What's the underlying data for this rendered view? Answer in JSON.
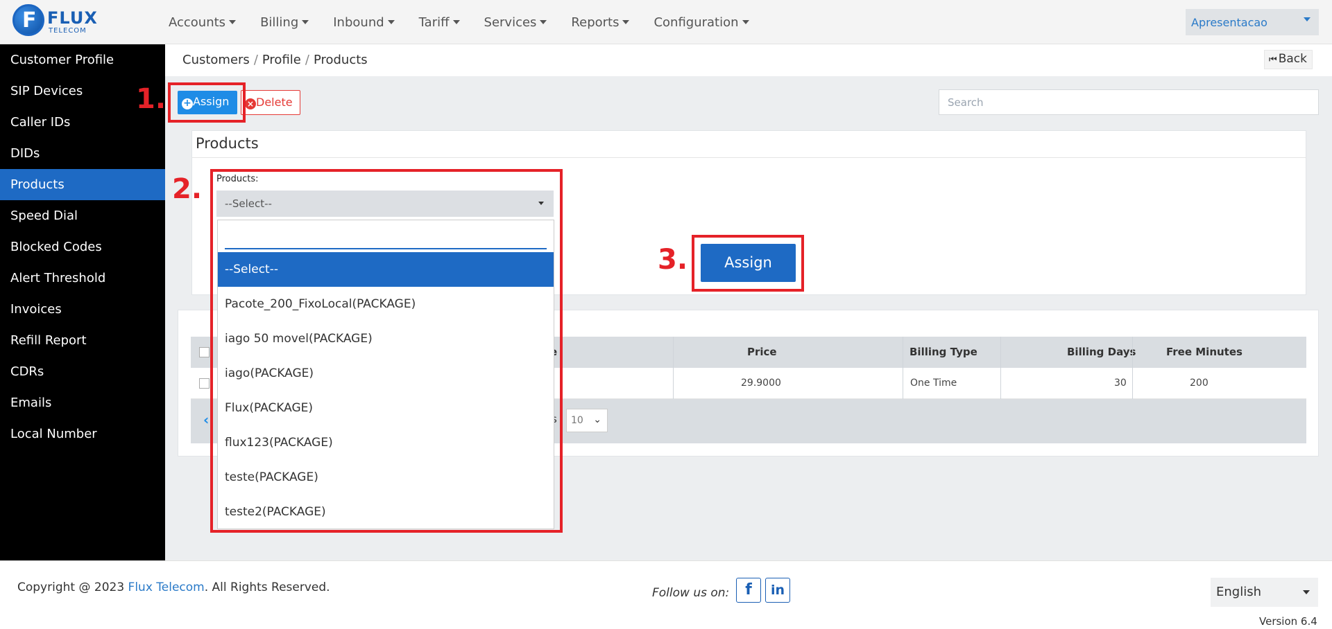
{
  "brand": {
    "name": "FLUX",
    "sub": "TELECOM"
  },
  "nav": {
    "items": [
      "Accounts",
      "Billing",
      "Inbound",
      "Tariff",
      "Services",
      "Reports",
      "Configuration"
    ],
    "account": "Apresentacao"
  },
  "sidebar": {
    "items": [
      "Customer Profile",
      "SIP Devices",
      "Caller IDs",
      "DIDs",
      "Products",
      "Speed Dial",
      "Blocked Codes",
      "Alert Threshold",
      "Invoices",
      "Refill Report",
      "CDRs",
      "Emails",
      "Local Number"
    ],
    "active": "Products"
  },
  "breadcrumb": {
    "items": [
      "Customers",
      "Profile",
      "Products"
    ]
  },
  "back_label": "Back",
  "toolbar": {
    "assign_label": "Assign",
    "delete_label": "Delete",
    "search_placeholder": "Search"
  },
  "products_panel": {
    "title": "Products",
    "field_label": "Products:",
    "selected": "--Select--",
    "assign_button": "Assign"
  },
  "dropdown": {
    "options": [
      "--Select--",
      "Pacote_200_FixoLocal(PACKAGE)",
      "iago 50 movel(PACKAGE)",
      "iago(PACKAGE)",
      "Flux(PACKAGE)",
      "flux123(PACKAGE)",
      "teste(PACKAGE)",
      "teste2(PACKAGE)"
    ]
  },
  "table": {
    "headers": [
      "e",
      "Price",
      "Billing Type",
      "Billing Days",
      "Free Minutes"
    ],
    "row": {
      "price": "29.9000",
      "billing_type": "One Time",
      "billing_days": "30",
      "free_minutes": "200"
    },
    "page_size": "10",
    "pager_fragment": "s"
  },
  "annotations": [
    "1.",
    "2.",
    "3."
  ],
  "footer": {
    "copyright_prefix": "Copyright @ 2023 ",
    "company": "Flux Telecom",
    "copyright_suffix": ". All Rights Reserved.",
    "follow": "Follow us on:",
    "facebook": "f",
    "linkedin": "in",
    "language": "English",
    "version": "Version 6.4"
  },
  "colors": {
    "primary": "#1e6ac4",
    "annotation": "#e52228",
    "sidebar_bg": "#000000"
  }
}
